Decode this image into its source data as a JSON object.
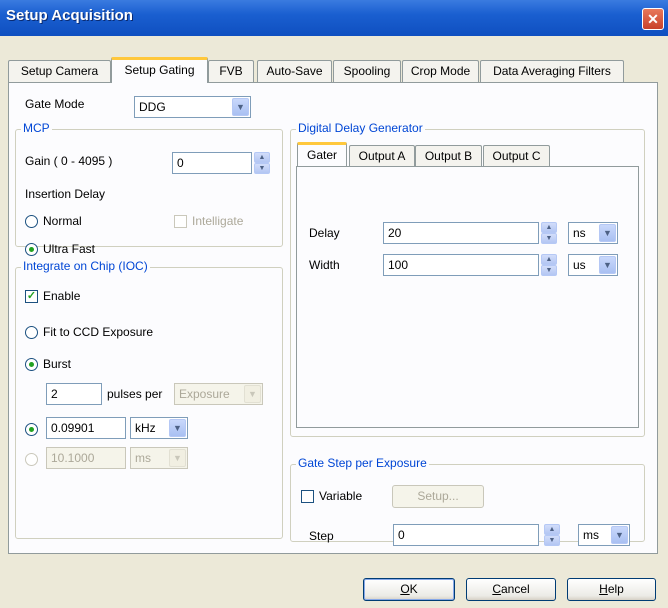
{
  "window": {
    "title": "Setup Acquisition",
    "close": "✕"
  },
  "tabs": [
    "Setup Camera",
    "Setup Gating",
    "FVB",
    "Auto-Save",
    "Spooling",
    "Crop Mode",
    "Data Averaging Filters"
  ],
  "gate_mode": {
    "label": "Gate Mode",
    "value": "DDG"
  },
  "mcp": {
    "title": "MCP",
    "gain_label": "Gain ( 0 - 4095 )",
    "gain_value": "0",
    "insertion_delay_label": "Insertion Delay",
    "normal_label": "Normal",
    "intelligate_label": "Intelligate",
    "ultra_fast_label": "Ultra Fast"
  },
  "ioc": {
    "title": "Integrate on Chip (IOC)",
    "enable_label": "Enable",
    "fit_label": "Fit to CCD Exposure",
    "burst_label": "Burst",
    "pulses_value": "2",
    "pulses_per_label": "pulses per",
    "exposure_value": "Exposure",
    "freq_value": "0.09901",
    "freq_unit": "kHz",
    "period_value": "10.1000",
    "period_unit": "ms"
  },
  "ddg": {
    "title": "Digital Delay Generator",
    "tabs": [
      "Gater",
      "Output A",
      "Output B",
      "Output C"
    ],
    "delay_label": "Delay",
    "delay_value": "20",
    "delay_unit": "ns",
    "width_label": "Width",
    "width_value": "100",
    "width_unit": "us"
  },
  "gate_step": {
    "title": "Gate Step per Exposure",
    "variable_label": "Variable",
    "setup_button": "Setup...",
    "step_label": "Step",
    "step_value": "0",
    "step_unit": "ms"
  },
  "buttons": {
    "ok_key": "O",
    "ok_rest": "K",
    "cancel_key": "C",
    "cancel_rest": "ancel",
    "help_key": "H",
    "help_rest": "elp"
  }
}
